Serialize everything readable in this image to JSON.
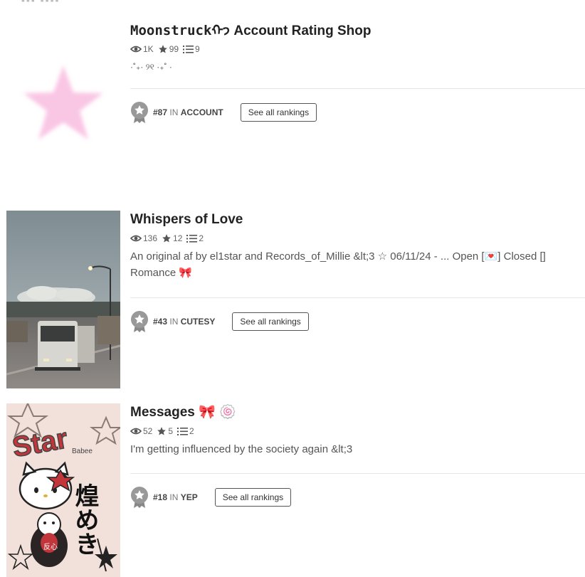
{
  "stories": [
    {
      "title_main": "Moonstruck",
      "title_glyph": "ᡣ𐭩",
      "title_rest": " Account Rating Shop",
      "views": "1K",
      "votes": "99",
      "parts": "9",
      "description": "·˚₊· ୨୧ ·₊˚ ·",
      "rank_number": "#87",
      "rank_in": "IN",
      "rank_category": "ACCOUNT",
      "rank_button": "See all rankings"
    },
    {
      "title_main": "Whispers of Love",
      "views": "136",
      "votes": "12",
      "parts": "2",
      "description": "An original af by el1star and Records_of_Millie &lt;3 ☆ 06/11/24 - ... Open [💌] Closed [] Romance 🎀",
      "rank_number": "#43",
      "rank_in": "IN",
      "rank_category": "CUTESY",
      "rank_button": "See all rankings"
    },
    {
      "title_main": "Messages 🎀 🍥",
      "views": "52",
      "votes": "5",
      "parts": "2",
      "description": "I'm getting influenced by the society again &lt;3",
      "rank_number": "#18",
      "rank_in": "IN",
      "rank_category": "YEP",
      "rank_button": "See all rankings"
    }
  ],
  "cover_art": {
    "messages_text_star": "Star",
    "messages_text_babee": "Babee",
    "messages_text_jp": "煌めき",
    "messages_text_small": "反心"
  },
  "icons": {
    "views": "eye-icon",
    "votes": "star-icon",
    "parts": "list-icon",
    "rank": "ribbon-badge-icon"
  },
  "colors": {
    "pink_star": "#f9c6e4",
    "sky": "#8e9ba0",
    "red_cover": "#c2353a"
  }
}
